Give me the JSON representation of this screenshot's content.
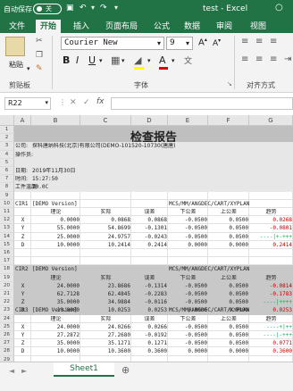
{
  "window": {
    "autosave_label": "自动保存",
    "autosave_state": "关",
    "title": "test  -  Excel"
  },
  "tabs": [
    "文件",
    "开始",
    "插入",
    "页面布局",
    "公式",
    "数据",
    "审阅",
    "视图"
  ],
  "ribbon": {
    "font_name": "Courier New",
    "font_size": "9",
    "paste": "粘贴",
    "clipboard_group": "剪贴板",
    "font_group": "字体",
    "align_group": "对齐方式"
  },
  "formula": {
    "name_box": "R22",
    "fx": "fx"
  },
  "columns": [
    "A",
    "B",
    "C",
    "D",
    "E",
    "F",
    "G"
  ],
  "rows": [
    "1",
    "2",
    "3",
    "4",
    "5",
    "6",
    "7",
    "8",
    "9",
    "10",
    "11",
    "12",
    "13",
    "14",
    "15",
    "16",
    "17",
    "18",
    "19",
    "20",
    "21",
    "22",
    "23",
    "24",
    "25",
    "26",
    "27",
    "28",
    "29",
    "30"
  ],
  "report": {
    "title": "检查报告",
    "company_label": "公司:",
    "company_value": "探科唐纳科技(北京)有限公司(DEMO-101520-10730(唐唐)",
    "operator_label": "操作员:",
    "date_label": "日期:",
    "date_value": "2019年11月30日",
    "time_label": "时间:",
    "time_value": "15:27:50",
    "temp_label": "工件温度:",
    "temp_value": "20.0C"
  },
  "headers": [
    "理论",
    "实际",
    "误差",
    "下公差",
    "上公差",
    "趋势"
  ],
  "blocks": [
    {
      "name": "CIR1",
      "version": "[DEMO Version]",
      "path": "MCS/MM/ANGDEC/CART/XYPLAN",
      "rows": [
        {
          "axis": "X",
          "theo": "0.0000",
          "act": "0.0868",
          "err": "0.0868",
          "lo": "-0.0500",
          "hi": "0.0500",
          "trend": "0.0268",
          "trend_color": "#c00000"
        },
        {
          "axis": "Y",
          "theo": "55.0000",
          "act": "54.8699",
          "err": "-0.1301",
          "lo": "-0.0500",
          "hi": "0.0500",
          "trend": "-0.0801",
          "trend_color": "#c00000"
        },
        {
          "axis": "Z",
          "theo": "25.0000",
          "act": "24.9757",
          "err": "-0.0243",
          "lo": "-0.0500",
          "hi": "0.0500",
          "trend": "----|+-+++",
          "trend_color": "#00b050"
        },
        {
          "axis": "D",
          "theo": "10.0000",
          "act": "10.2414",
          "err": "0.2414",
          "lo": "0.0000",
          "hi": "0.0000",
          "trend": "0.2414",
          "trend_color": "#c00000"
        }
      ]
    },
    {
      "name": "CIR2",
      "version": "[DEMO Version]",
      "path": "MCS/MM/ANGDEC/CART/XYPLAN",
      "rows": [
        {
          "axis": "X",
          "theo": "24.0000",
          "act": "23.8686",
          "err": "-0.1314",
          "lo": "-0.0500",
          "hi": "0.0500",
          "trend": "-0.0814",
          "trend_color": "#c00000"
        },
        {
          "axis": "Y",
          "theo": "62.7128",
          "act": "62.4845",
          "err": "-0.2283",
          "lo": "-0.0500",
          "hi": "0.0500",
          "trend": "-0.1783",
          "trend_color": "#c00000"
        },
        {
          "axis": "Z",
          "theo": "35.0000",
          "act": "34.9884",
          "err": "-0.0116",
          "lo": "-0.0500",
          "hi": "0.0500",
          "trend": "----|++++",
          "trend_color": "#00b050"
        },
        {
          "axis": "D",
          "theo": "10.0000",
          "act": "10.0253",
          "err": "0.0253",
          "lo": "0.0000",
          "hi": "0.0000",
          "trend": "0.0253",
          "trend_color": "#c00000"
        }
      ]
    },
    {
      "name": "CIR3",
      "version": "[DEMO Version]",
      "path": "MCS/MM/ANGDEC/CART/XYPLAN",
      "rows": [
        {
          "axis": "X",
          "theo": "24.0000",
          "act": "24.0266",
          "err": "0.0266",
          "lo": "-0.0500",
          "hi": "0.0500",
          "trend": "----+|++",
          "trend_color": "#00b050"
        },
        {
          "axis": "Y",
          "theo": "27.2872",
          "act": "27.2680",
          "err": "-0.0192",
          "lo": "-0.0500",
          "hi": "0.0500",
          "trend": "----|-+++",
          "trend_color": "#00b050"
        },
        {
          "axis": "Z",
          "theo": "35.0000",
          "act": "35.1271",
          "err": "0.1271",
          "lo": "-0.0500",
          "hi": "0.0500",
          "trend": "0.0771",
          "trend_color": "#c00000"
        },
        {
          "axis": "D",
          "theo": "10.0000",
          "act": "10.3600",
          "err": "0.3600",
          "lo": "0.0000",
          "hi": "0.0000",
          "trend": "0.3600",
          "trend_color": "#c00000"
        }
      ]
    }
  ],
  "sheet_tab": "Sheet1"
}
